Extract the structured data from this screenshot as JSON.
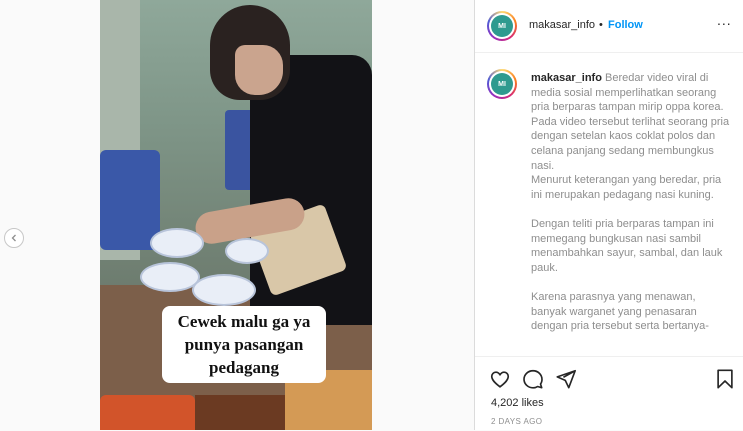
{
  "post": {
    "username": "makasar_info",
    "separator": "•",
    "follow_label": "Follow",
    "more_label": "...",
    "video_caption": [
      "Cewek malu ga ya",
      "punya pasangan",
      "pedagang"
    ],
    "avatar_text": "MI"
  },
  "comment": {
    "username": "makasar_info",
    "paragraphs": [
      "Beredar video viral di media sosial memperlihatkan seorang pria berparas tampan mirip oppa korea.",
      "Pada video tersebut terlihat seorang pria dengan setelan kaos coklat polos dan celana panjang sedang membungkus nasi.",
      "Menurut keterangan yang beredar, pria ini merupakan pedagang nasi kuning.",
      "",
      "Dengan teliti pria berparas tampan ini memegang bungkusan nasi sambil menambahkan sayur, sambal, dan lauk pauk.",
      "",
      "Karena parasnya yang menawan, banyak warganet yang penasaran dengan pria tersebut serta bertanya-"
    ]
  },
  "actions": {
    "icons": [
      "heart-icon",
      "comment-icon",
      "share-icon",
      "bookmark-icon"
    ]
  },
  "stats": {
    "likes": "4,202 likes",
    "date": "2 DAYS AGO"
  },
  "colors": {
    "link": "#0095f6",
    "text": "#262626",
    "muted": "#8e8e8e"
  }
}
